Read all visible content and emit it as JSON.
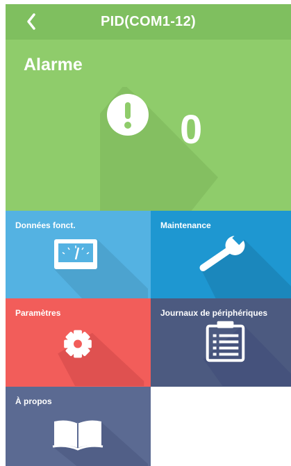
{
  "header": {
    "title": "PID(COM1-12)",
    "back_icon": "chevron-left-icon"
  },
  "alarm": {
    "label": "Alarme",
    "count": "0",
    "icon": "exclamation-circle-icon"
  },
  "tiles": [
    {
      "label": "Données fonct.",
      "icon": "gauge-icon",
      "color": "#54b2e2"
    },
    {
      "label": "Maintenance",
      "icon": "wrench-icon",
      "color": "#1e97d1"
    },
    {
      "label": "Paramètres",
      "icon": "gear-icon",
      "color": "#f25d5a"
    },
    {
      "label": "Journaux de périphériques",
      "icon": "clipboard-list-icon",
      "color": "#4c5a80"
    },
    {
      "label": "À propos",
      "icon": "book-icon",
      "color": "#5b6a92"
    }
  ],
  "colors": {
    "header": "#7fbf5f",
    "alarm": "#8fcc6b"
  }
}
